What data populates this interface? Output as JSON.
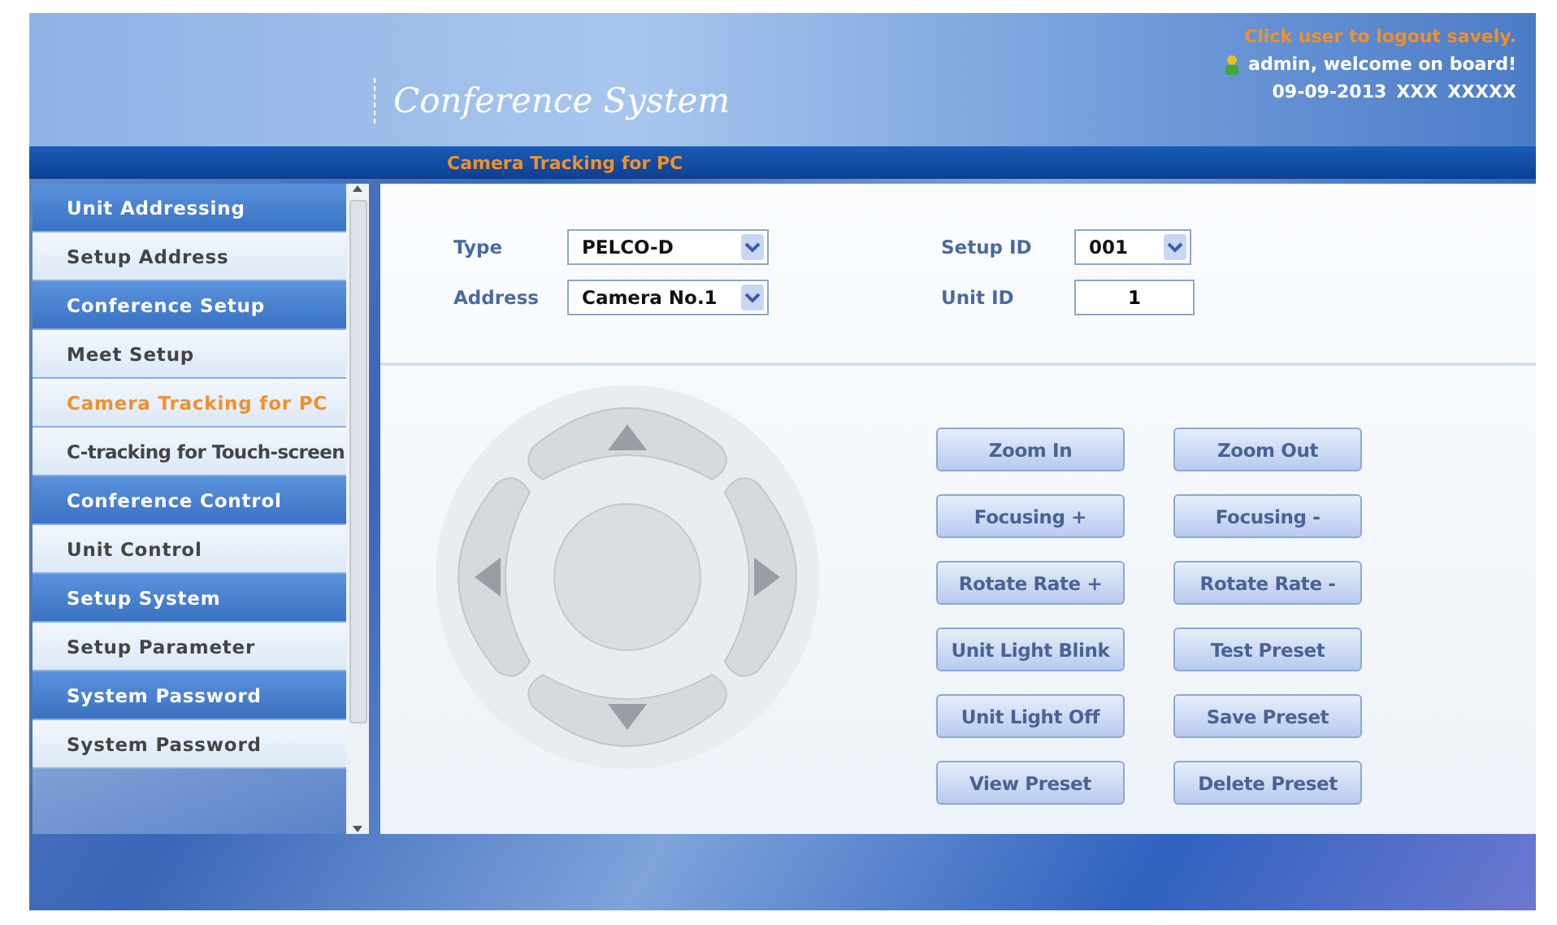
{
  "header": {
    "title": "Conference System",
    "logout_hint": "Click user to logout savely.",
    "welcome": "admin, welcome on board!",
    "date": "09-09-2013",
    "date_extra": [
      "XXX",
      "XXXXX"
    ]
  },
  "nav_bar": {
    "title": "Camera Tracking for PC"
  },
  "sidebar": {
    "items": [
      {
        "kind": "header",
        "label": "Unit Addressing"
      },
      {
        "kind": "item",
        "label": "Setup Address",
        "selected": false
      },
      {
        "kind": "header",
        "label": "Conference Setup"
      },
      {
        "kind": "item",
        "label": "Meet Setup",
        "selected": false
      },
      {
        "kind": "item",
        "label": "Camera Tracking for PC",
        "selected": true
      },
      {
        "kind": "item",
        "label": "C-tracking for Touch-screen",
        "selected": false
      },
      {
        "kind": "header",
        "label": "Conference Control"
      },
      {
        "kind": "item",
        "label": "Unit Control",
        "selected": false
      },
      {
        "kind": "header",
        "label": "Setup System"
      },
      {
        "kind": "item",
        "label": "Setup Parameter",
        "selected": false
      },
      {
        "kind": "header",
        "label": "System Password"
      },
      {
        "kind": "item",
        "label": "System Password",
        "selected": false
      }
    ]
  },
  "form": {
    "fields": [
      {
        "kind": "select",
        "label": "Type",
        "value": "PELCO-D"
      },
      {
        "kind": "select",
        "label": "Setup ID",
        "value": "001"
      },
      {
        "kind": "select",
        "label": "Address",
        "value": "Camera No.1"
      },
      {
        "kind": "input",
        "label": "Unit ID",
        "value": "1"
      }
    ]
  },
  "buttons": [
    "Zoom In",
    "Zoom Out",
    "Focusing +",
    "Focusing -",
    "Rotate Rate +",
    "Rotate Rate -",
    "Unit Light Blink",
    "Test Preset",
    "Unit Light Off",
    "Save Preset",
    "View Preset",
    "Delete Preset"
  ]
}
